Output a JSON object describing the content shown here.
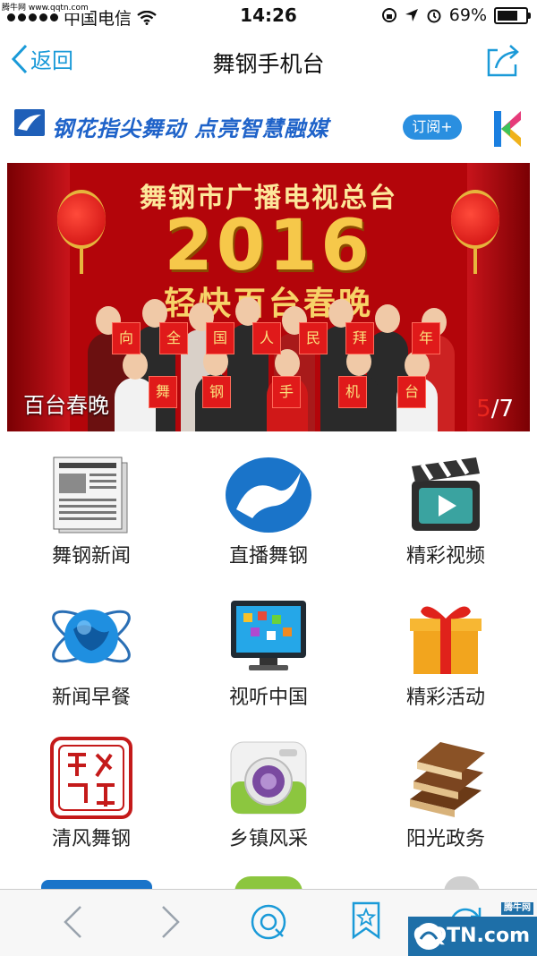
{
  "status_bar": {
    "carrier": "中国电信",
    "time": "14:26",
    "battery": "69%",
    "watermark": "腾牛网 www.qqtn.com"
  },
  "nav": {
    "back_label": "返回",
    "title": "舞钢手机台"
  },
  "ad_bar": {
    "slogan": "钢花指尖舞动 点亮智慧融媒",
    "subscribe_label": "订阅+"
  },
  "banner": {
    "line1": "舞钢市广播电视总台",
    "line2": "2016",
    "line3": "轻快百台春晚",
    "signs": [
      "向",
      "全",
      "国",
      "人",
      "民",
      "拜",
      "年",
      "舞",
      "钢",
      "手",
      "机",
      "台"
    ],
    "caption": "百台春晚",
    "current": "5",
    "total": "/7"
  },
  "grid": [
    {
      "label": "舞钢新闻",
      "icon": "newspaper-icon"
    },
    {
      "label": "直播舞钢",
      "icon": "live-logo-icon"
    },
    {
      "label": "精彩视频",
      "icon": "clapperboard-icon"
    },
    {
      "label": "新闻早餐",
      "icon": "globe-orbit-icon"
    },
    {
      "label": "视听中国",
      "icon": "tv-screen-icon"
    },
    {
      "label": "精彩活动",
      "icon": "gift-box-icon"
    },
    {
      "label": "清风舞钢",
      "icon": "seal-stamp-icon"
    },
    {
      "label": "乡镇风采",
      "icon": "camera-icon"
    },
    {
      "label": "阳光政务",
      "icon": "books-icon"
    }
  ],
  "toolbar": {
    "watermark": "QQTN.com",
    "watermark_tag": "腾牛网"
  },
  "colors": {
    "accent": "#1a9ad8",
    "banner_red": "#b3050a",
    "counter_red": "#e8261e"
  }
}
